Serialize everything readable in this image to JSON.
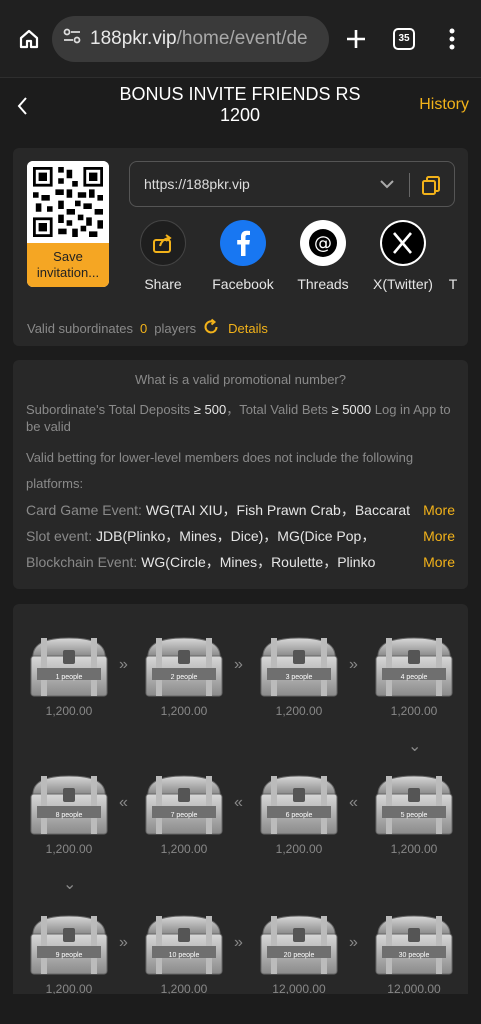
{
  "browser": {
    "url_host": "188pkr.vip",
    "url_path": "/home/event/de",
    "tab_count": "35"
  },
  "header": {
    "title": "BONUS INVITE FRIENDS RS 1200",
    "history": "History"
  },
  "invite": {
    "save_label": "Save invitation...",
    "url": "https://188pkr.vip",
    "shares": [
      {
        "label": "Share",
        "icon": "share-icon"
      },
      {
        "label": "Facebook",
        "icon": "facebook-icon"
      },
      {
        "label": "Threads",
        "icon": "threads-icon"
      },
      {
        "label": "X(Twitter)",
        "icon": "x-twitter-icon"
      },
      {
        "label": "T",
        "icon": "telegram-icon"
      }
    ],
    "valid_label": "Valid subordinates",
    "valid_count": "0",
    "valid_unit": "players",
    "details": "Details"
  },
  "rules": {
    "question": "What is a valid promotional number?",
    "cond_pre": "Subordinate's Total Deposits",
    "cond_dep": "≥ 500",
    "cond_mid": "，Total Valid Bets",
    "cond_bet": "≥ 5000",
    "cond_post": "Log in App to be valid",
    "platforms": "Valid betting for lower-level members does not include the following platforms:",
    "events": [
      {
        "k": "Card Game Event:",
        "v": "WG(TAI XIU，Fish Prawn Crab，Baccarat",
        "more": "More"
      },
      {
        "k": "Slot event:",
        "v": "JDB(Plinko，Mines，Dice)，MG(Dice Pop，",
        "more": "More"
      },
      {
        "k": "Blockchain Event:",
        "v": "WG(Circle，Mines，Roulette，Plinko",
        "more": "More"
      }
    ]
  },
  "chests": [
    {
      "people": "1 people",
      "amount": "1,200.00"
    },
    {
      "people": "2 people",
      "amount": "1,200.00"
    },
    {
      "people": "3 people",
      "amount": "1,200.00"
    },
    {
      "people": "4 people",
      "amount": "1,200.00"
    },
    {
      "people": "8 people",
      "amount": "1,200.00"
    },
    {
      "people": "7 people",
      "amount": "1,200.00"
    },
    {
      "people": "6 people",
      "amount": "1,200.00"
    },
    {
      "people": "5 people",
      "amount": "1,200.00"
    },
    {
      "people": "9 people",
      "amount": "1,200.00"
    },
    {
      "people": "10 people",
      "amount": "1,200.00"
    },
    {
      "people": "20 people",
      "amount": "12,000.00"
    },
    {
      "people": "30 people",
      "amount": "12,000.00"
    }
  ]
}
